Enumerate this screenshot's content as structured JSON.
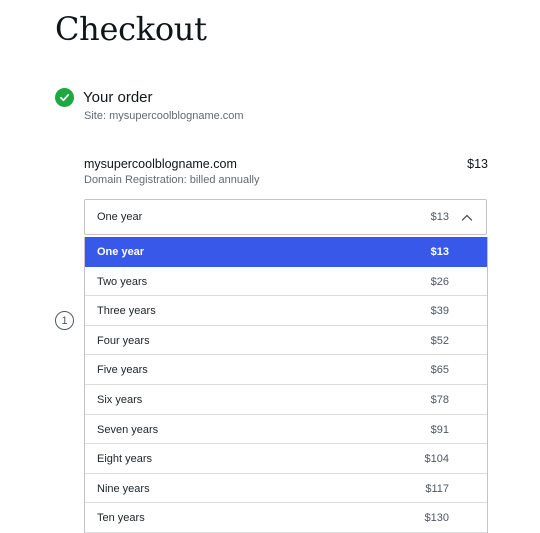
{
  "page_title": "Checkout",
  "step_completed": {
    "icon": "checkmark-icon",
    "color": "#1fa742",
    "title": "Your order",
    "subtitle": "Site: mysupercoolblogname.com"
  },
  "order_item": {
    "name": "mysupercoolblogname.com",
    "price": "$13",
    "description": "Domain Registration: billed annually"
  },
  "next_step": {
    "number": "1"
  },
  "term_select": {
    "selected_label": "One year",
    "selected_price": "$13",
    "expanded": true,
    "highlight_color": "#3858e9",
    "options": [
      {
        "label": "One year",
        "price": "$13",
        "selected": true
      },
      {
        "label": "Two years",
        "price": "$26"
      },
      {
        "label": "Three years",
        "price": "$39"
      },
      {
        "label": "Four years",
        "price": "$52"
      },
      {
        "label": "Five years",
        "price": "$65"
      },
      {
        "label": "Six years",
        "price": "$78"
      },
      {
        "label": "Seven years",
        "price": "$91"
      },
      {
        "label": "Eight years",
        "price": "$104"
      },
      {
        "label": "Nine years",
        "price": "$117"
      },
      {
        "label": "Ten years",
        "price": "$130"
      }
    ]
  }
}
